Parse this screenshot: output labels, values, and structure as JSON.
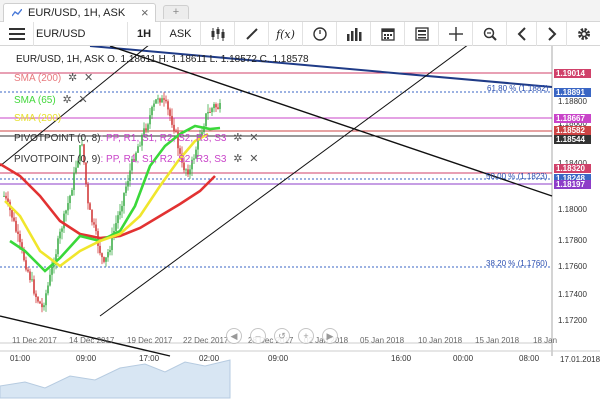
{
  "window": {
    "tab_title": "EUR/USD, 1H, ASK",
    "tab_close": "×",
    "tab_add": "+"
  },
  "toolbar": {
    "symbol_value": "EUR/USD",
    "timeframe": "1H",
    "price_type": "ASK",
    "icons": [
      "menu-icon",
      "candle-type-icon",
      "draw-line-icon",
      "function-icon",
      "clock-icon",
      "bar-chart-icon",
      "calendar-icon",
      "template-icon",
      "crosshair-icon",
      "zoom-icon",
      "scroll-left-icon",
      "scroll-right-icon",
      "settings-icon"
    ],
    "function_label": "f(x)"
  },
  "chart": {
    "header": "EUR/USD, 1H, ASK   O. 1.18611 H. 1.18611 L. 1.18572 C. 1.18578",
    "indicators": [
      {
        "label": "SMA (200)",
        "color": "#e8787c"
      },
      {
        "label": "SMA (65)",
        "color": "#41d83a"
      },
      {
        "label": "SMA (200)",
        "color": "#e7e12f"
      },
      {
        "label": "PIVOTPOINT (0, 8)",
        "color": "#333333",
        "levels": ": PP, R1, S1, R2, S2, R3, S3"
      },
      {
        "label": "PIVOTPOINT (0, 9)",
        "color": "#333333",
        "levels": ": PP, R1, S1, R2, S2, R3, S3"
      }
    ],
    "legend_controls": {
      "settings": "✲",
      "remove": "✕"
    },
    "y_ticks": [
      "1.18800",
      "1.18600",
      "1.18400",
      "1.18000",
      "1.17800",
      "1.17600",
      "1.17400",
      "1.17200"
    ],
    "price_boxes": [
      {
        "label": "1.19014",
        "color": "#d0416a"
      },
      {
        "label": "1.18891",
        "color": "#3a66c4"
      },
      {
        "label": "1.18667",
        "color": "#c944c9"
      },
      {
        "label": "1.18582",
        "color": "#cc4444"
      },
      {
        "label": "1.18544",
        "color": "#333333"
      },
      {
        "label": "1.18320",
        "color": "#d0416a"
      },
      {
        "label": "1.18248",
        "color": "#3a66c4"
      },
      {
        "label": "1.18197",
        "color": "#8d3cc8"
      }
    ],
    "fib_levels": [
      {
        "label": "61.80 % (1.1882)"
      },
      {
        "label": "50.00 % (1.1823)"
      },
      {
        "label": "38.20 % (1.1760)"
      }
    ],
    "x_ticks": [
      "11 Dec 2017",
      "14 Dec 2017",
      "19 Dec 2017",
      "22 Dec 2017",
      "28 Dec 2017",
      "02 Jan 2018",
      "05 Jan 2018",
      "10 Jan 2018",
      "15 Jan 2018",
      "18 Jan"
    ],
    "bottom_ticks": [
      "01:00",
      "09:00",
      "17:00",
      "02:00",
      "09:00",
      "16:00",
      "00:00",
      "08:00"
    ],
    "navigator_date": "17.01.2018",
    "nav_buttons": [
      "◀",
      "–",
      "↺",
      "+",
      "▶"
    ]
  }
}
